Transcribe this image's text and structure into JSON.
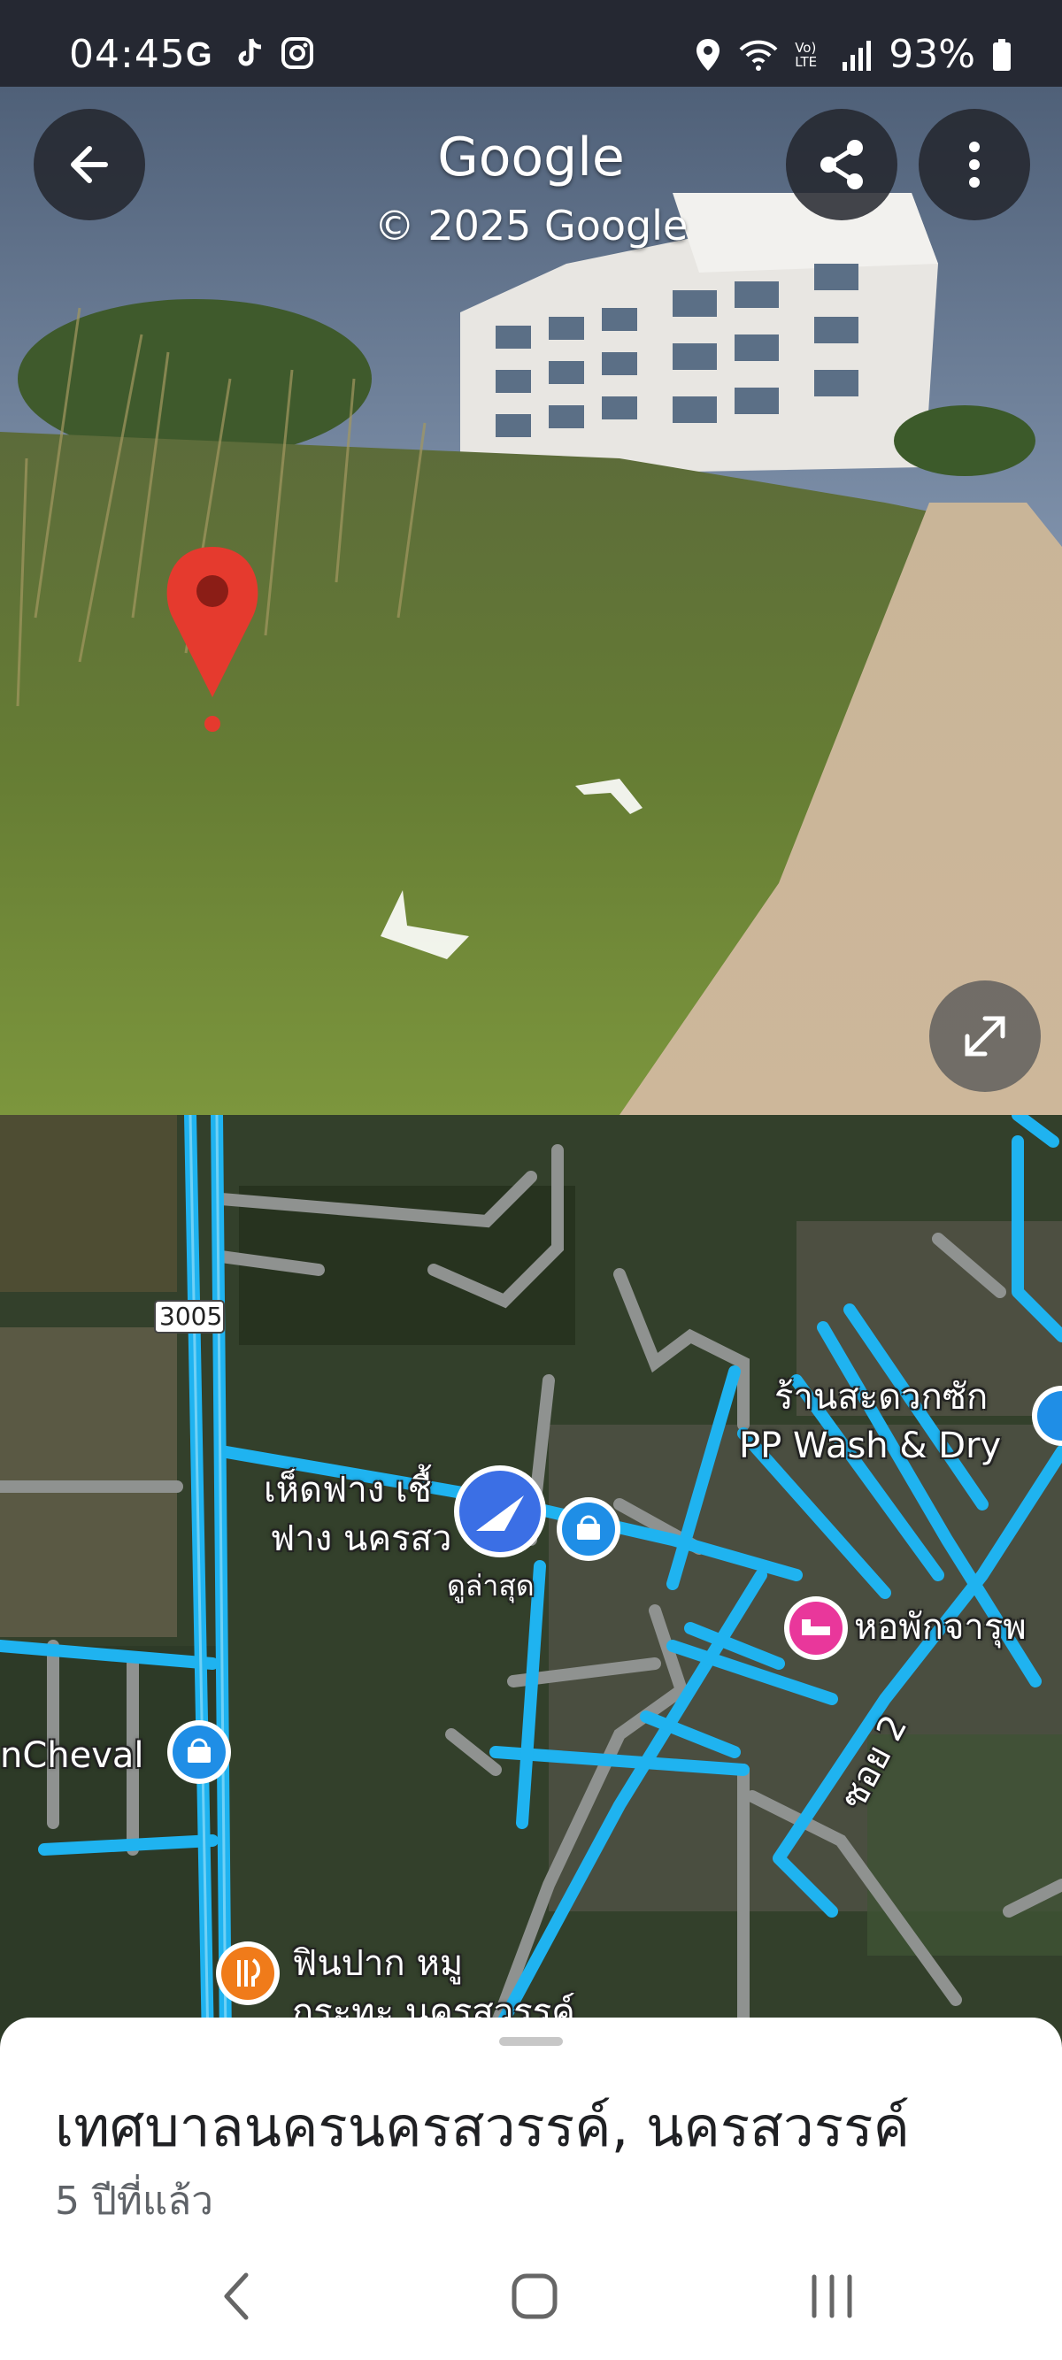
{
  "status_bar": {
    "time": "04:45",
    "left_icons": [
      "google-icon",
      "tiktok-icon",
      "instagram-icon"
    ],
    "right_icons": [
      "location-icon",
      "wifi-icon",
      "volte-icon",
      "signal-icon",
      "battery-icon"
    ],
    "volte_label": "Vo) LTE",
    "battery": "93%"
  },
  "street_view": {
    "title": "Google",
    "copyright": "© 2025 Google",
    "buttons": [
      "back-icon",
      "share-icon",
      "more-icon",
      "expand-icon"
    ]
  },
  "map": {
    "road_shield": "3005",
    "labels": {
      "laundry_line1": "ร้านสะดวกซัก",
      "laundry_line2": "PP Wash & Dry",
      "mushroom_line1": "เห็ดฟาง เชื้",
      "mushroom_line2": "ฟาง นครสว",
      "latest": "ดูล่าสุด",
      "dorm": "หอพักจารุพ",
      "cheval": "nCheval",
      "soi": "ซอย 2",
      "restaurant_line1": "ฟินปาก หมู",
      "restaurant_line2": "กระทะ นครสวรรค์"
    },
    "colors": {
      "route": "#1fb3f0",
      "road": "#9a9a9a",
      "pin_blue": "#3b6fe5",
      "pin_pink": "#e9379b",
      "pin_orange": "#f07b1a"
    }
  },
  "sheet": {
    "place_name": "เทศบาลนครนครสวรรค์, นครสวรรค์",
    "time_ago": "5 ปีที่แล้ว"
  },
  "nav_bar": {
    "buttons": [
      "back-nav-icon",
      "home-nav-icon",
      "recents-nav-icon"
    ]
  }
}
